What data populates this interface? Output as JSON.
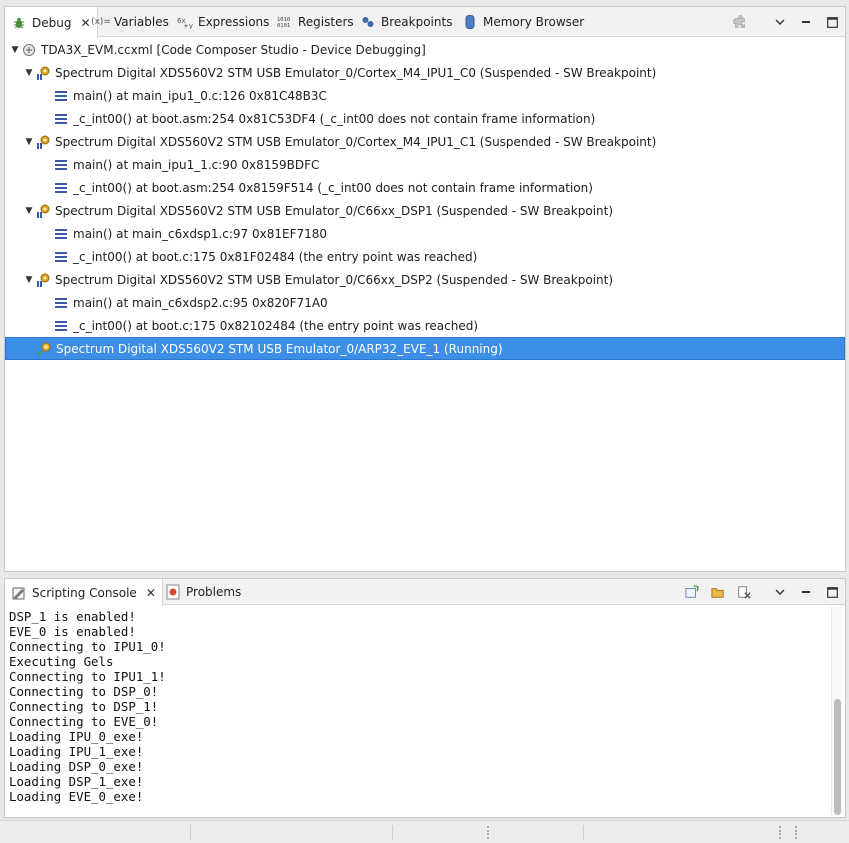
{
  "debug_view": {
    "tabs": [
      {
        "label": "Debug",
        "icon": "bug-icon",
        "active": true
      },
      {
        "label": "Variables",
        "icon": "variables-icon"
      },
      {
        "label": "Expressions",
        "icon": "expressions-icon"
      },
      {
        "label": "Registers",
        "icon": "registers-icon"
      },
      {
        "label": "Breakpoints",
        "icon": "breakpoints-icon"
      },
      {
        "label": "Memory Browser",
        "icon": "memory-icon"
      }
    ],
    "close_glyph": "✕",
    "tree": {
      "root": "TDA3X_EVM.ccxml [Code Composer Studio - Device Debugging]",
      "targets": [
        {
          "label": "Spectrum Digital XDS560V2 STM USB Emulator_0/Cortex_M4_IPU1_C0 (Suspended - SW Breakpoint)",
          "frames": [
            "main() at main_ipu1_0.c:126 0x81C48B3C",
            "_c_int00() at boot.asm:254 0x81C53DF4  (_c_int00 does not contain frame information)"
          ]
        },
        {
          "label": "Spectrum Digital XDS560V2 STM USB Emulator_0/Cortex_M4_IPU1_C1 (Suspended - SW Breakpoint)",
          "frames": [
            "main() at main_ipu1_1.c:90 0x8159BDFC",
            "_c_int00() at boot.asm:254 0x8159F514  (_c_int00 does not contain frame information)"
          ]
        },
        {
          "label": "Spectrum Digital XDS560V2 STM USB Emulator_0/C66xx_DSP1 (Suspended - SW Breakpoint)",
          "frames": [
            "main() at main_c6xdsp1.c:97 0x81EF7180",
            "_c_int00() at boot.c:175 0x81F02484  (the entry point was reached)"
          ]
        },
        {
          "label": "Spectrum Digital XDS560V2 STM USB Emulator_0/C66xx_DSP2 (Suspended - SW Breakpoint)",
          "frames": [
            "main() at main_c6xdsp2.c:95 0x820F71A0",
            "_c_int00() at boot.c:175 0x82102484  (the entry point was reached)"
          ]
        }
      ],
      "running_target": "Spectrum Digital XDS560V2 STM USB Emulator_0/ARP32_EVE_1 (Running)"
    }
  },
  "console_view": {
    "tabs": [
      {
        "label": "Scripting Console",
        "icon": "console-icon",
        "active": true
      },
      {
        "label": "Problems",
        "icon": "problems-icon"
      }
    ],
    "lines": [
      "DSP_1 is enabled!",
      "EVE_0 is enabled!",
      "Connecting to IPU1_0!",
      "Executing Gels",
      "Connecting to IPU1_1!",
      "Connecting to DSP_0!",
      "Connecting to DSP_1!",
      "Connecting to EVE_0!",
      "Loading IPU_0_exe!",
      "Loading IPU_1_exe!",
      "Loading DSP_0_exe!",
      "Loading DSP_1_exe!",
      "Loading EVE_0_exe!"
    ]
  },
  "colors": {
    "selection": "#3d8ee6",
    "frame_icon": "#3b58a4",
    "target_icon": "#d9a21c"
  }
}
